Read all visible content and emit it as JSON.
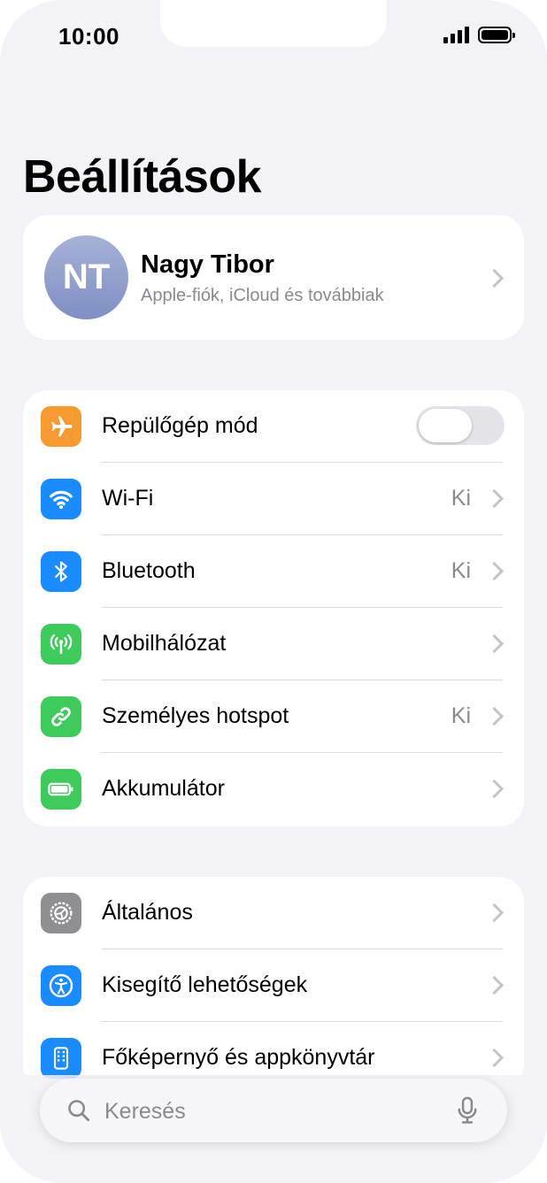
{
  "status": {
    "time": "10:00"
  },
  "page_title": "Beállítások",
  "account": {
    "initials": "NT",
    "name": "Nagy Tibor",
    "subtitle": "Apple-fiók, iCloud és továbbiak"
  },
  "group1": [
    {
      "label": "Repülőgép mód",
      "icon": "airplane-icon",
      "color": "#f69a31",
      "toggle": false
    },
    {
      "label": "Wi-Fi",
      "icon": "wifi-icon",
      "color": "#1a8cff",
      "value": "Ki"
    },
    {
      "label": "Bluetooth",
      "icon": "bluetooth-icon",
      "color": "#1a8cff",
      "value": "Ki"
    },
    {
      "label": "Mobilhálózat",
      "icon": "antenna-icon",
      "color": "#3ecb5c"
    },
    {
      "label": "Személyes hotspot",
      "icon": "hotspot-link-icon",
      "color": "#3ecb5c",
      "value": "Ki"
    },
    {
      "label": "Akkumulátor",
      "icon": "battery-icon",
      "color": "#3ecb5c"
    }
  ],
  "group2": [
    {
      "label": "Általános",
      "icon": "gear-icon",
      "color": "#8e8e93"
    },
    {
      "label": "Kisegítő lehetőségek",
      "icon": "accessibility-icon",
      "color": "#1a8cff"
    },
    {
      "label": "Főképernyő és appkönyvtár",
      "icon": "home-screen-icon",
      "color": "#1a8cff"
    }
  ],
  "search": {
    "placeholder": "Keresés"
  }
}
